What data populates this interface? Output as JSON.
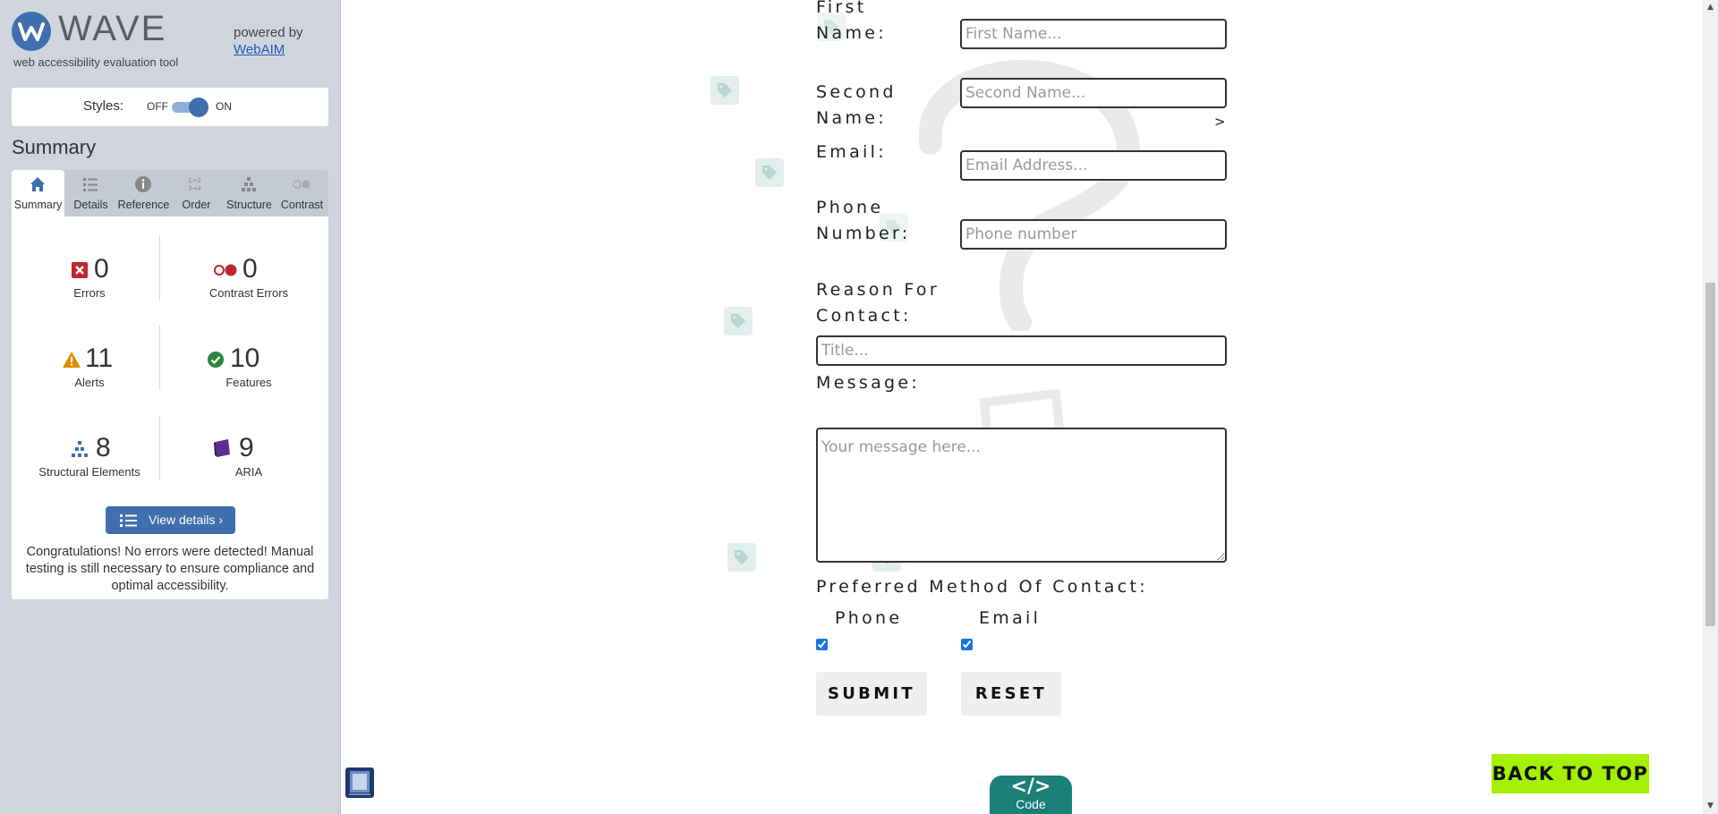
{
  "wave": {
    "title": "WAVE",
    "subtitle": "web accessibility evaluation tool",
    "powered_by": "powered by",
    "webaim_link": "WebAIM",
    "styles_label": "Styles:",
    "styles_off": "OFF",
    "styles_on": "ON",
    "styles_enabled": true,
    "summary_heading": "Summary",
    "tabs": [
      {
        "label": "Summary",
        "icon": "home-icon",
        "active": true
      },
      {
        "label": "Details",
        "icon": "list-icon",
        "active": false
      },
      {
        "label": "Reference",
        "icon": "info-icon",
        "active": false
      },
      {
        "label": "Order",
        "icon": "order-icon",
        "active": false
      },
      {
        "label": "Structure",
        "icon": "structure-icon",
        "active": false
      },
      {
        "label": "Contrast",
        "icon": "contrast-icon",
        "active": false
      }
    ],
    "stats": {
      "errors": {
        "count": "0",
        "label": "Errors",
        "color": "#c0272d"
      },
      "contrast": {
        "count": "0",
        "label": "Contrast Errors",
        "color": "#c0272d"
      },
      "alerts": {
        "count": "11",
        "label": "Alerts",
        "color": "#e08c00"
      },
      "features": {
        "count": "10",
        "label": "Features",
        "color": "#2e8540"
      },
      "structural": {
        "count": "8",
        "label": "Structural Elements",
        "color": "#3f6fae"
      },
      "aria": {
        "count": "9",
        "label": "ARIA",
        "color": "#5b2d90"
      }
    },
    "view_details": "View details ›",
    "congrats": "Congratulations! No errors were detected! Manual testing is still necessary to ensure compliance and optimal accessibility.",
    "accent_color": "#3f6fae"
  },
  "form": {
    "first_name_label": "First Name:",
    "first_name_placeholder": "First Name...",
    "second_name_label": "Second Name:",
    "second_name_placeholder": "Second Name...",
    "email_label": "Email:",
    "email_placeholder": "Email Address...",
    "phone_label": "Phone Number:",
    "phone_placeholder": "Phone number",
    "reason_label": "Reason For Contact:",
    "reason_placeholder": "Title...",
    "message_label": "Message:",
    "message_placeholder": "Your message here...",
    "preferred_label": "Preferred Method Of Contact:",
    "phone_option": "Phone",
    "email_option": "Email",
    "phone_checked": true,
    "email_checked": true,
    "submit": "SUBMIT",
    "reset": "RESET",
    "stray_text": ">"
  },
  "back_to_top": "BACK TO TOP",
  "code_tab": {
    "symbol": "</>",
    "label": "Code"
  }
}
